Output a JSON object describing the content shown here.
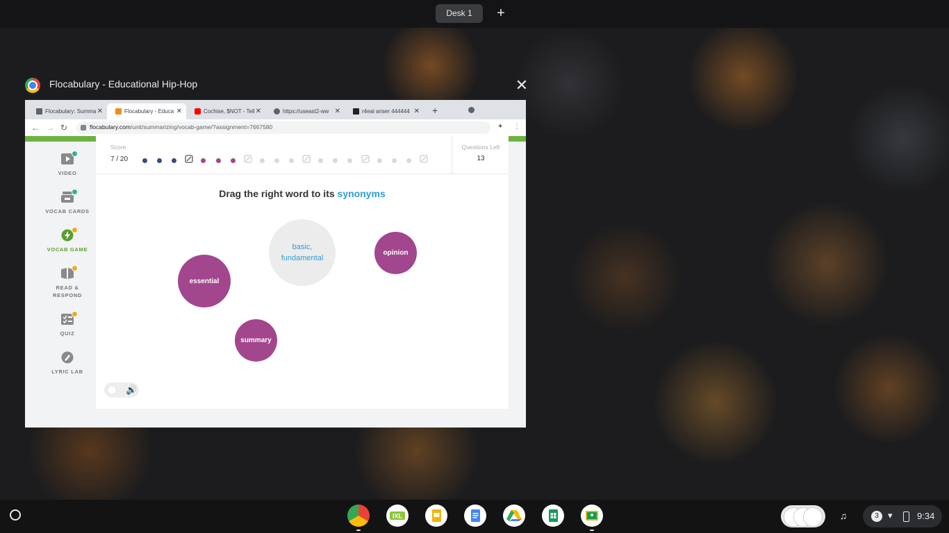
{
  "desk": {
    "label": "Desk 1",
    "add": "+"
  },
  "window": {
    "title": "Flocabulary - Educational Hip-Hop",
    "close": "✕"
  },
  "tabs": [
    {
      "label": "Flocabulary: Summa",
      "favicon_color": "#5f6368"
    },
    {
      "label": "Flocabulary - Educa",
      "favicon_color": "#f28b1f"
    },
    {
      "label": "Cochise, $NOT - Tell",
      "favicon_color": "#ff0000"
    },
    {
      "label": "https://useast2-ww",
      "favicon_color": "#5f6368"
    },
    {
      "label": "r4eal anser 444444",
      "favicon_color": "#202124"
    }
  ],
  "toolbar": {
    "url_host": "flocabulary.com",
    "url_path": "/unit/summarizing/vocab-game/?assignment=7667580"
  },
  "sidebar": {
    "items": [
      {
        "label": "VIDEO",
        "status": "complete"
      },
      {
        "label": "VOCAB CARDS",
        "status": "complete"
      },
      {
        "label": "VOCAB GAME",
        "status": "in-progress"
      },
      {
        "label": "READ &\nRESPOND",
        "status": "in-progress"
      },
      {
        "label": "QUIZ",
        "status": "in-progress"
      },
      {
        "label": "LYRIC LAB",
        "status": "none"
      }
    ]
  },
  "game": {
    "score_label": "Score",
    "score_value": "7 / 20",
    "questions_left_label": "Questions Left",
    "questions_left_value": "13",
    "prompt_text": "Drag the right word to its ",
    "prompt_highlight": "synonyms",
    "target": "basic,\nfundamental",
    "words": [
      "essential",
      "opinion",
      "summary"
    ],
    "progress_dots": [
      "navy",
      "navy",
      "navy",
      "icon",
      "purple",
      "purple",
      "purple",
      "icon",
      "gray",
      "gray",
      "gray",
      "icon",
      "gray",
      "gray",
      "gray",
      "icon",
      "gray",
      "gray",
      "gray",
      "icon"
    ]
  },
  "colors": {
    "accent_green": "#6cb33f",
    "word_purple": "#a2468e",
    "highlight_blue": "#2a9fd6",
    "dot_navy": "#3d4a7a",
    "dot_gray": "#d9d9d9"
  },
  "shelf": {
    "apps": [
      "chrome",
      "ixl",
      "slides",
      "docs",
      "drive",
      "sheets",
      "classroom"
    ],
    "notifications": "3",
    "time": "9:34"
  }
}
